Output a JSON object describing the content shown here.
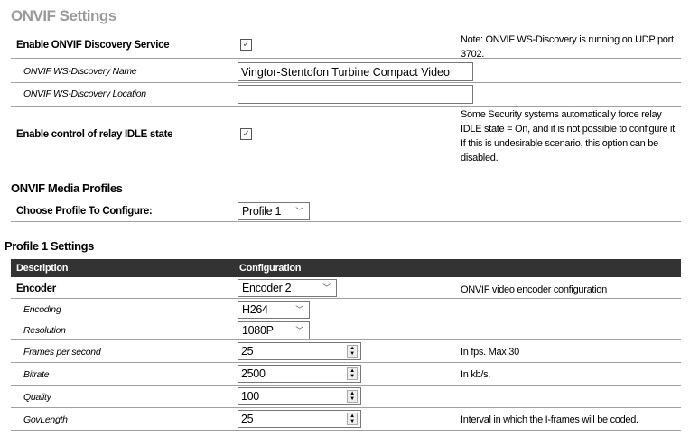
{
  "title": "ONVIF Settings",
  "discovery": {
    "label": "Enable ONVIF Discovery Service",
    "checked": true,
    "note": "Note: ONVIF WS-Discovery is running on UDP port 3702.",
    "name_label": "ONVIF WS-Discovery Name",
    "name_value": "Vingtor-Stentofon Turbine Compact Video",
    "location_label": "ONVIF WS-Discovery Location",
    "location_value": ""
  },
  "relay": {
    "label": "Enable control of relay IDLE state",
    "checked": true,
    "note": "Some Security systems automatically force relay IDLE state = On, and it is not possible to configure it. If this is undesirable scenario, this option can be disabled."
  },
  "media": {
    "title": "ONVIF Media Profiles",
    "choose_label": "Choose Profile To Configure:",
    "profile": "Profile 1"
  },
  "profile_settings": {
    "title": "Profile 1 Settings",
    "col_description": "Description",
    "col_configuration": "Configuration",
    "encoder": {
      "label": "Encoder",
      "value": "Encoder 2",
      "note": "ONVIF video encoder configuration"
    },
    "encoding": {
      "label": "Encoding",
      "value": "H264"
    },
    "resolution": {
      "label": "Resolution",
      "value": "1080P"
    },
    "fps": {
      "label": "Frames per second",
      "value": "25",
      "note": "In fps. Max 30"
    },
    "bitrate": {
      "label": "Bitrate",
      "value": "2500",
      "note": "In kb/s."
    },
    "quality": {
      "label": "Quality",
      "value": "100"
    },
    "govlength": {
      "label": "GovLength",
      "value": "25",
      "note": "Interval in which the I-frames will be coded."
    }
  }
}
